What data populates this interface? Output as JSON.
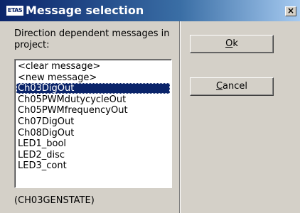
{
  "window": {
    "icon_text": "ETAS",
    "title": "Message selection",
    "close_glyph": "×"
  },
  "dialog": {
    "direction_label": "Direction dependent messages in project:",
    "messages": [
      "<clear message>",
      "<new message>",
      "Ch03DigOut",
      "Ch05PWMdutycycleOut",
      "Ch05PWMfrequencyOut",
      "Ch07DigOut",
      "Ch08DigOut",
      "LED1_bool",
      "LED2_disc",
      "LED3_cont"
    ],
    "selected_index": 2,
    "footer_text": "(CH03GENSTATE)"
  },
  "buttons": {
    "ok_label": "Ok",
    "cancel_label": "Cancel"
  },
  "colors": {
    "titlebar_start": "#0a246a",
    "selection": "#0a246a",
    "face": "#d4d0c8"
  }
}
